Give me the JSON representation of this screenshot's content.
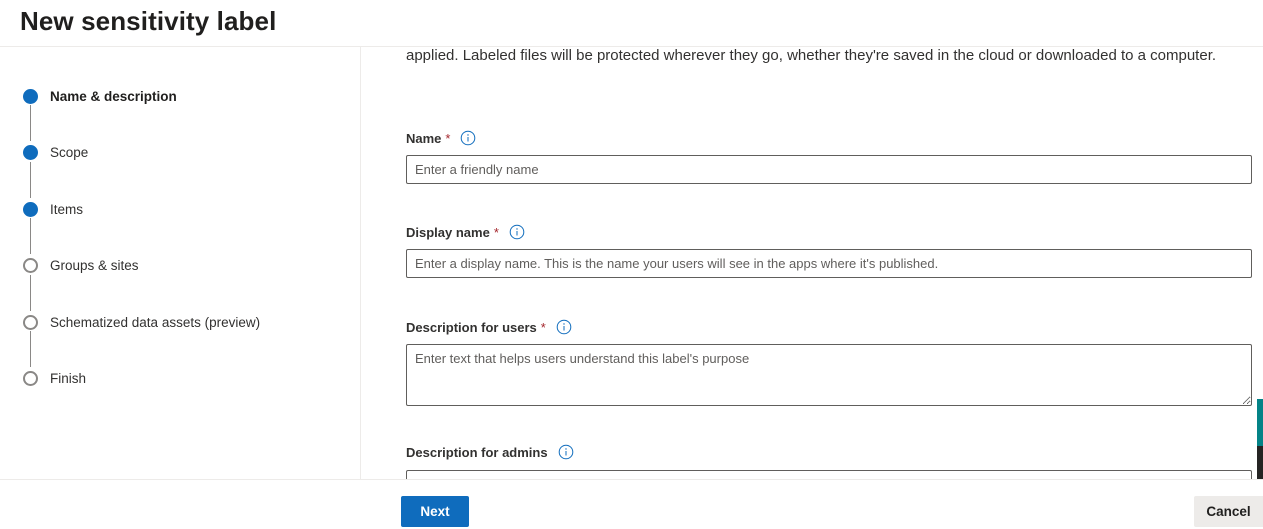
{
  "page": {
    "title": "New sensitivity label"
  },
  "wizard": {
    "steps": [
      {
        "label": "Name & description",
        "status": "current"
      },
      {
        "label": "Scope",
        "status": "done"
      },
      {
        "label": "Items",
        "status": "done"
      },
      {
        "label": "Groups & sites",
        "status": "pending"
      },
      {
        "label": "Schematized data assets (preview)",
        "status": "pending"
      },
      {
        "label": "Finish",
        "status": "pending"
      }
    ]
  },
  "form": {
    "intro_text": "applied. Labeled files will be protected wherever they go, whether they're saved in the cloud or downloaded to a computer.",
    "name": {
      "label": "Name",
      "required_marker": "*",
      "placeholder": "Enter a friendly name",
      "value": ""
    },
    "display_name": {
      "label": "Display name",
      "required_marker": "*",
      "placeholder": "Enter a display name. This is the name your users will see in the apps where it's published.",
      "value": ""
    },
    "description_users": {
      "label": "Description for users",
      "required_marker": "*",
      "placeholder": "Enter text that helps users understand this label's purpose",
      "value": ""
    },
    "description_admins": {
      "label": "Description for admins",
      "value": ""
    }
  },
  "footer": {
    "next_label": "Next",
    "cancel_label": "Cancel"
  },
  "colors": {
    "accent": "#0f6cbd",
    "required": "#a4262c",
    "border": "#605e5c"
  },
  "icons": {
    "info": "info-icon",
    "step_done": "filled-circle-icon",
    "step_pending": "empty-circle-icon"
  }
}
